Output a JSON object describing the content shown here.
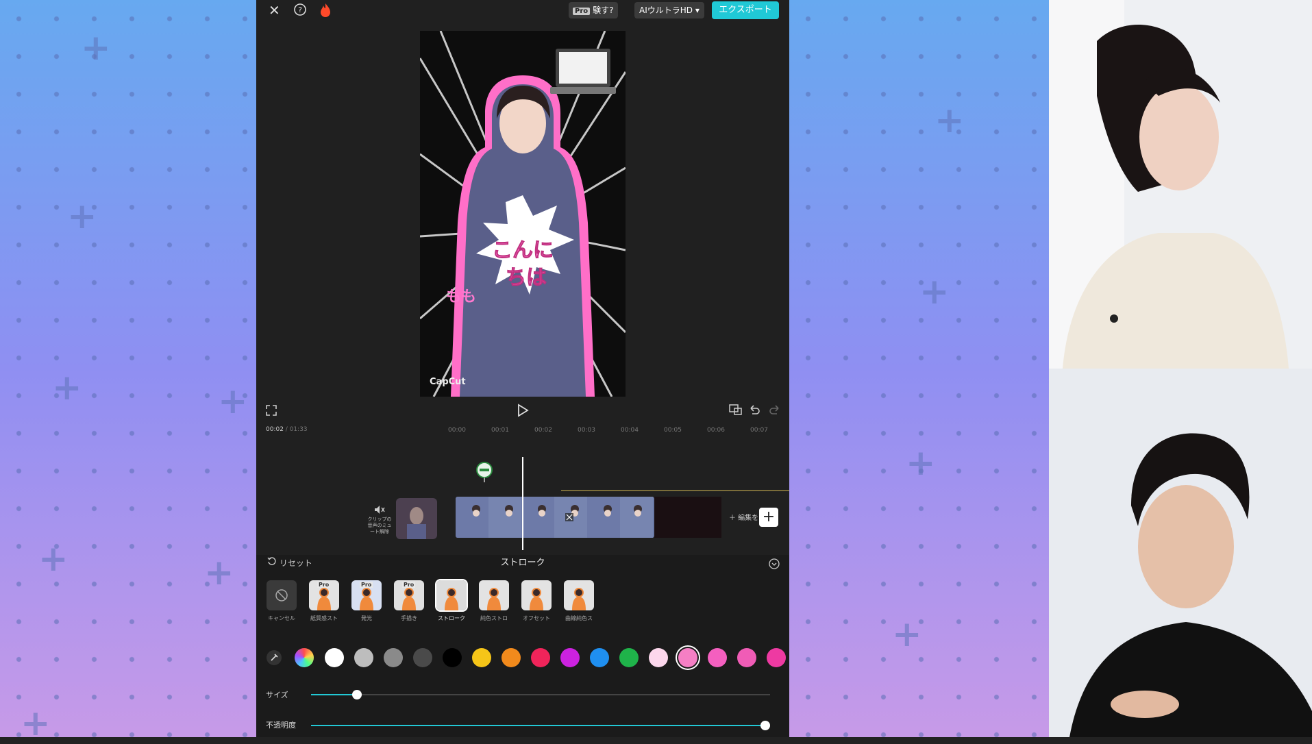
{
  "colors": {
    "accent": "#20c9d6",
    "panel": "#1b1b1b",
    "app_bg": "#202020"
  },
  "topbar": {
    "pro_tag": "Pro",
    "pro_label": "験す?",
    "resolution_label": "AIウルトラHD ▾",
    "export_label": "エクスポート"
  },
  "preview": {
    "watermark": "CapCut",
    "bubble_text_1": "こんに",
    "bubble_text_2": "ちは",
    "side_text": "もも"
  },
  "time": {
    "current": "00:02",
    "total": "01:33",
    "ticks": [
      "00:00",
      "00:01",
      "00:02",
      "00:03",
      "00:04",
      "00:05",
      "00:06",
      "00:07"
    ]
  },
  "timeline": {
    "mute_label": "クリップの音声のミュート解除",
    "add_label": "＋ 編集を"
  },
  "panel": {
    "reset_label": "リセット",
    "title": "ストローク",
    "effects": [
      {
        "label": "キャンセル",
        "pro": false
      },
      {
        "label": "紙質感スト",
        "pro": true
      },
      {
        "label": "発光",
        "pro": true
      },
      {
        "label": "手描き",
        "pro": true
      },
      {
        "label": "ストローク",
        "pro": false
      },
      {
        "label": "純色ストロ",
        "pro": false
      },
      {
        "label": "オフセット",
        "pro": false
      },
      {
        "label": "曲線純色ス",
        "pro": false
      }
    ],
    "pro_badge": "Pro",
    "swatches": [
      "#ffffff",
      "#bdbdbd",
      "#8a8a8a",
      "#4a4a4a",
      "#000000",
      "#f5c518",
      "#f28a1c",
      "#f0245a",
      "#cc22e0",
      "#1f8ff0",
      "#1fb34a",
      "#fcd7ec",
      "#f57fc4",
      "#f45fbf",
      "#f05cb6",
      "#ee3aa2"
    ],
    "size_label": "サイズ",
    "size_value": 0.1,
    "opacity_label": "不透明度",
    "opacity_value": 1.0
  }
}
